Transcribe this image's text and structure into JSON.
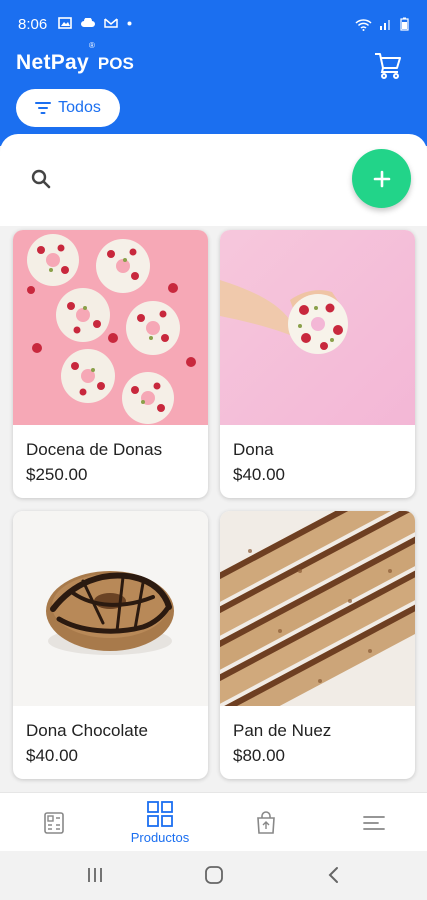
{
  "status_bar": {
    "time": "8:06"
  },
  "app": {
    "logo_main": "NetPay",
    "logo_mark": "®",
    "logo_suffix": "POS"
  },
  "filter": {
    "label": "Todos"
  },
  "products": [
    {
      "name": "Docena de Donas",
      "price": "$250.00"
    },
    {
      "name": "Dona",
      "price": "$40.00"
    },
    {
      "name": "Dona Chocolate",
      "price": "$40.00"
    },
    {
      "name": "Pan de Nuez",
      "price": "$80.00"
    }
  ],
  "bottom_nav": {
    "items": [
      {
        "icon": "register-icon",
        "label": ""
      },
      {
        "icon": "products-grid-icon",
        "label": "Productos",
        "active": true
      },
      {
        "icon": "shopping-bag-icon",
        "label": ""
      },
      {
        "icon": "menu-icon",
        "label": ""
      }
    ]
  },
  "colors": {
    "primary": "#1b6ff0",
    "accent": "#22d489"
  }
}
